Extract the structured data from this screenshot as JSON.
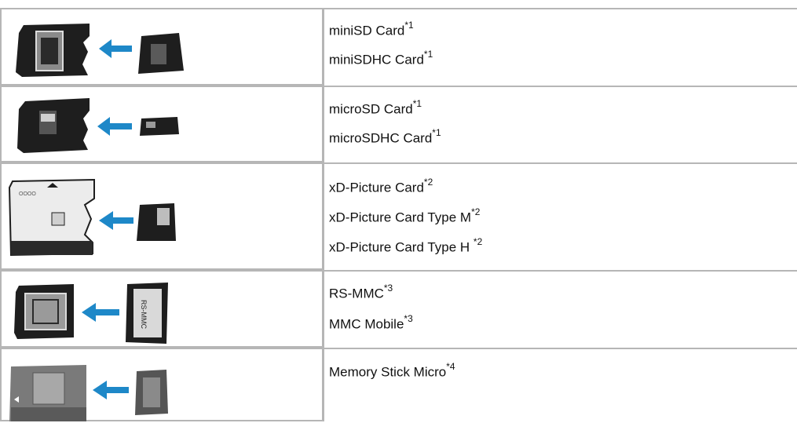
{
  "rows": [
    {
      "icon": "minisd-adapter-icon",
      "items": [
        {
          "text": "miniSD Card",
          "note": "*1"
        },
        {
          "text": "miniSDHC Card",
          "note": "*1"
        }
      ]
    },
    {
      "icon": "microsd-adapter-icon",
      "items": [
        {
          "text": "microSD Card",
          "note": "*1"
        },
        {
          "text": "microSDHC Card",
          "note": "*1"
        }
      ]
    },
    {
      "icon": "xd-picture-adapter-icon",
      "items": [
        {
          "text": "xD-Picture Card",
          "note": "*2"
        },
        {
          "text": "xD-Picture Card Type M",
          "note": "*2"
        },
        {
          "text": "xD-Picture Card Type H ",
          "note": "*2"
        }
      ]
    },
    {
      "icon": "rs-mmc-adapter-icon",
      "items": [
        {
          "text": "RS-MMC",
          "note": "*3"
        },
        {
          "text": "MMC Mobile",
          "note": "*3"
        }
      ]
    },
    {
      "icon": "memory-stick-micro-adapter-icon",
      "items": [
        {
          "text": "Memory Stick Micro",
          "note": "*4"
        }
      ]
    }
  ],
  "colors": {
    "arrow": "#1e88c8",
    "border": "#b6b6b6",
    "card": "#1e1e1e"
  }
}
